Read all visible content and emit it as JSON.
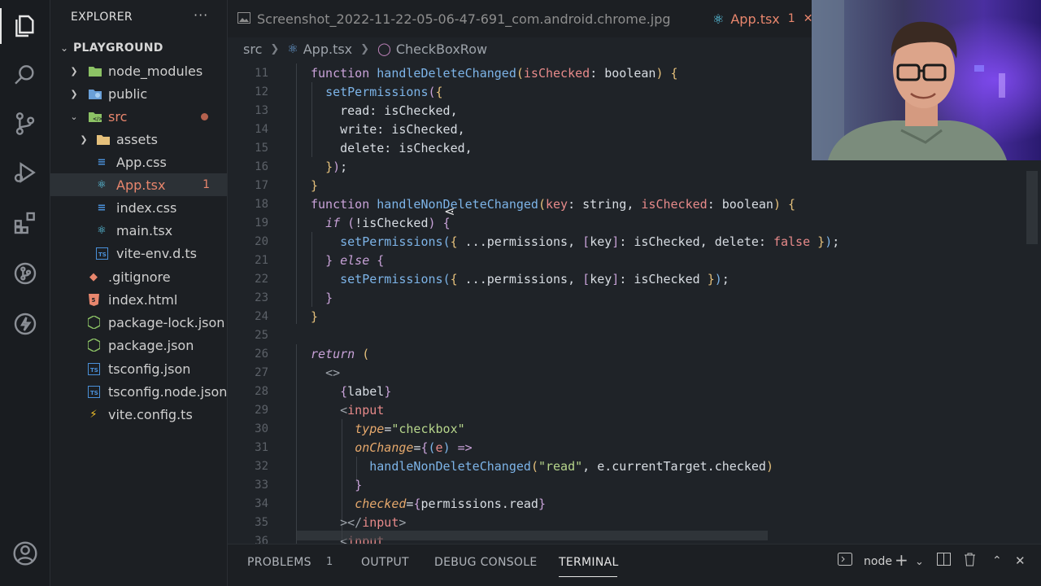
{
  "sidebar": {
    "title": "EXPLORER",
    "more": "···",
    "section": "PLAYGROUND",
    "items": [
      {
        "label": "node_modules",
        "kind": "folder",
        "icon": "node-folder-icon",
        "color": "#8cc265"
      },
      {
        "label": "public",
        "kind": "folder",
        "icon": "public-folder-icon",
        "color": "#6aa0d8"
      },
      {
        "label": "src",
        "kind": "folder-open",
        "icon": "src-folder-icon",
        "color": "#8cc265"
      },
      {
        "label": "assets",
        "kind": "folder",
        "icon": "folder-icon",
        "color": "#e5c07b"
      },
      {
        "label": "App.css",
        "kind": "file",
        "icon": "css-icon",
        "color": "#4a90d9"
      },
      {
        "label": "App.tsx",
        "kind": "file",
        "icon": "react-icon",
        "color": "#61dafb",
        "badge": "1"
      },
      {
        "label": "index.css",
        "kind": "file",
        "icon": "css-icon",
        "color": "#4a90d9"
      },
      {
        "label": "main.tsx",
        "kind": "file",
        "icon": "react-icon",
        "color": "#61dafb"
      },
      {
        "label": "vite-env.d.ts",
        "kind": "file",
        "icon": "ts-icon",
        "color": "#4a90d9"
      },
      {
        "label": ".gitignore",
        "kind": "file",
        "icon": "git-icon",
        "color": "#e8866d"
      },
      {
        "label": "index.html",
        "kind": "file",
        "icon": "html-icon",
        "color": "#e8866d"
      },
      {
        "label": "package-lock.json",
        "kind": "file",
        "icon": "nodejs-icon",
        "color": "#8cc265"
      },
      {
        "label": "package.json",
        "kind": "file",
        "icon": "nodejs-icon",
        "color": "#8cc265"
      },
      {
        "label": "tsconfig.json",
        "kind": "file",
        "icon": "ts-icon",
        "color": "#4a90d9"
      },
      {
        "label": "tsconfig.node.json",
        "kind": "file",
        "icon": "ts-icon",
        "color": "#4a90d9"
      },
      {
        "label": "vite.config.ts",
        "kind": "file",
        "icon": "vite-icon",
        "color": "#f7c52b"
      }
    ]
  },
  "tabs": {
    "inactive": "Screenshot_2022-11-22-05-06-47-691_com.android.chrome.jpg",
    "active": "App.tsx",
    "active_badge": "1"
  },
  "breadcrumb": {
    "parts": [
      "src",
      "App.tsx",
      "CheckBoxRow"
    ]
  },
  "code": {
    "line_numbers": [
      "11",
      "12",
      "13",
      "14",
      "15",
      "16",
      "17",
      "18",
      "19",
      "20",
      "21",
      "22",
      "23",
      "24",
      "25",
      "26",
      "27",
      "28",
      "29",
      "30",
      "31",
      "32",
      "33",
      "34",
      "35",
      "36"
    ]
  },
  "panel": {
    "tabs": [
      "PROBLEMS",
      "OUTPUT",
      "DEBUG CONSOLE",
      "TERMINAL"
    ],
    "problems_count": "1",
    "terminal_name": "node"
  }
}
